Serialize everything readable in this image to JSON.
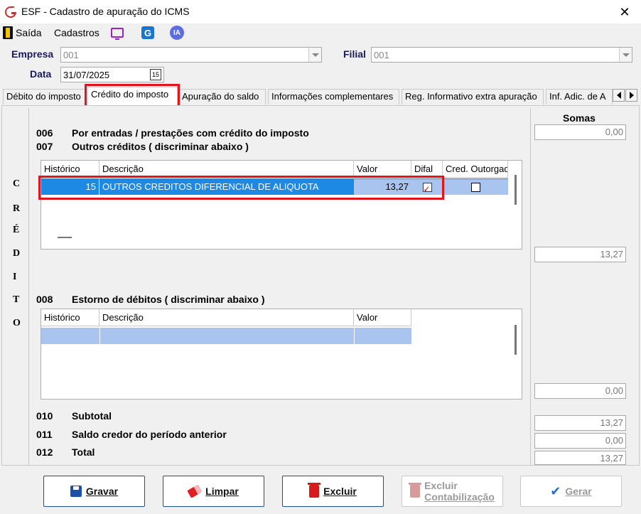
{
  "window": {
    "title": "ESF - Cadastro de apuração do ICMS",
    "close_glyph": "✕"
  },
  "toolbar": {
    "exit_label": "Saída",
    "registers_label": "Cadastros",
    "g_icon_text": "G",
    "ia_icon_text": "IA"
  },
  "header": {
    "empresa_label": "Empresa",
    "empresa_value": "001",
    "filial_label": "Filial",
    "filial_value": "001",
    "data_label": "Data",
    "data_value": "31/07/2025",
    "calendar_day": "15"
  },
  "tabs": [
    {
      "label": "Débito do imposto",
      "active": false
    },
    {
      "label": "Crédito do imposto",
      "active": true
    },
    {
      "label": "Apuração do saldo",
      "active": false
    },
    {
      "label": "Informações complementares",
      "active": false
    },
    {
      "label": "Reg. Informativo extra apuração",
      "active": false
    },
    {
      "label": "Inf. Adic. de A",
      "active": false
    }
  ],
  "side_title_letters": [
    "C",
    "R",
    "É",
    "D",
    "I",
    "T",
    "O"
  ],
  "sums_header": "Somas",
  "lines": {
    "l006": {
      "code": "006",
      "desc": "Por entradas / prestações com crédito do imposto",
      "sum": "0,00"
    },
    "l007": {
      "code": "007",
      "desc": "Outros créditos ( discriminar abaixo )",
      "sum": "13,27"
    },
    "l008": {
      "code": "008",
      "desc": "Estorno de débitos ( discriminar abaixo )",
      "sum": "0,00"
    },
    "l010": {
      "code": "010",
      "desc": "Subtotal",
      "sum": "13,27"
    },
    "l011": {
      "code": "011",
      "desc": "Saldo credor do período anterior",
      "sum": "0,00"
    },
    "l012": {
      "code": "012",
      "desc": "Total",
      "sum": "13,27"
    }
  },
  "grid_outros": {
    "columns": [
      "Histórico",
      "Descrição",
      "Valor",
      "Difal",
      "Cred. Outorgad"
    ],
    "rows": [
      {
        "historico": "15",
        "descricao": "OUTROS CREDITOS DIFERENCIAL DE ALIQUOTA",
        "valor": "13,27",
        "difal": true,
        "cred_outorgado": false
      }
    ]
  },
  "grid_estorno": {
    "columns": [
      "Histórico",
      "Descrição",
      "Valor"
    ],
    "rows": []
  },
  "buttons": {
    "save": "Gravar",
    "clear": "Limpar",
    "delete": "Excluir",
    "delete_accounting_line1": "Excluir",
    "delete_accounting_line2": "Contabilização",
    "generate": "Gerar"
  },
  "colors": {
    "highlight": "#e3131b",
    "selected_row": "#1e88e5",
    "empty_row": "#a9c4ee",
    "button_border": "#1d4e9e"
  }
}
